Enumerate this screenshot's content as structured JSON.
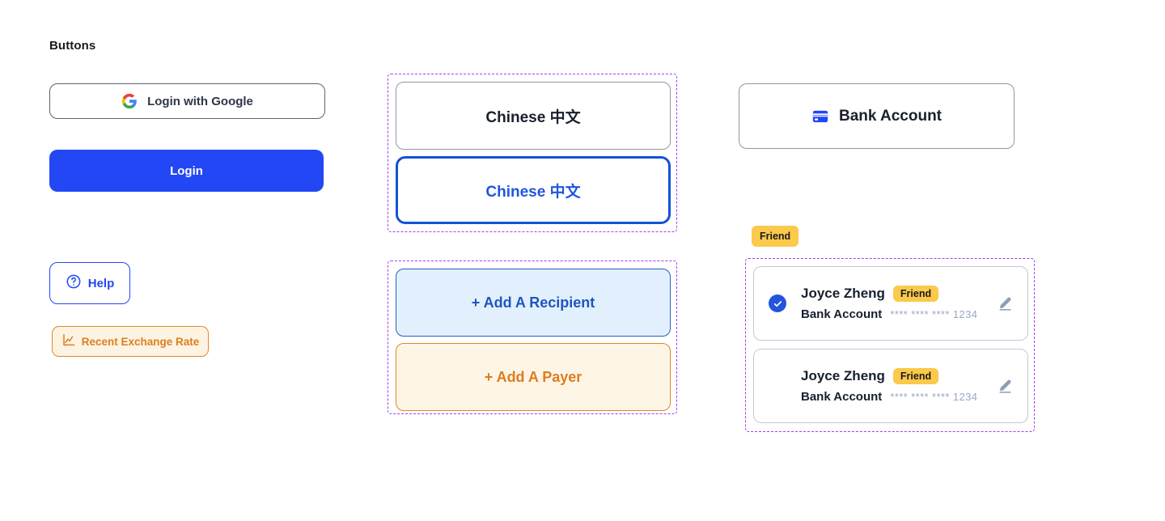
{
  "page": {
    "section_title": "Buttons"
  },
  "column_left": {
    "google_login": {
      "icon": "google-icon",
      "label": "Login with Google"
    },
    "login": {
      "label": "Login"
    },
    "help": {
      "icon": "question-circle-icon",
      "label": "Help"
    },
    "exchange_rate": {
      "icon": "line-chart-icon",
      "label": "Recent Exchange Rate"
    }
  },
  "column_middle": {
    "language_group": {
      "options": [
        {
          "label": "Chinese 中文",
          "state": "default"
        },
        {
          "label": "Chinese 中文",
          "state": "selected"
        }
      ]
    },
    "add_group": {
      "buttons": [
        {
          "label": "+ Add A Recipient",
          "variant": "blue"
        },
        {
          "label": "+ Add A Payer",
          "variant": "orange"
        }
      ]
    }
  },
  "column_right": {
    "bank_account": {
      "icon": "credit-card-icon",
      "label": "Bank Account"
    },
    "standalone_chip": {
      "label": "Friend"
    },
    "people": [
      {
        "selected": true,
        "name": "Joyce Zheng",
        "badge": "Friend",
        "account_label": "Bank Account",
        "account_mask": "**** **** **** 1234",
        "edit_icon": "pencil-icon"
      },
      {
        "selected": false,
        "name": "Joyce Zheng",
        "badge": "Friend",
        "account_label": "Bank Account",
        "account_mask": "**** **** **** 1234",
        "edit_icon": "pencil-icon"
      }
    ]
  },
  "colors": {
    "primary_blue": "#2347F5",
    "selected_blue": "#1352D8",
    "orange": "#E07C1C",
    "badge_yellow": "#FBC94B",
    "dashed_purple": "#A93FF0",
    "mask_gray": "#9AA8C4"
  }
}
